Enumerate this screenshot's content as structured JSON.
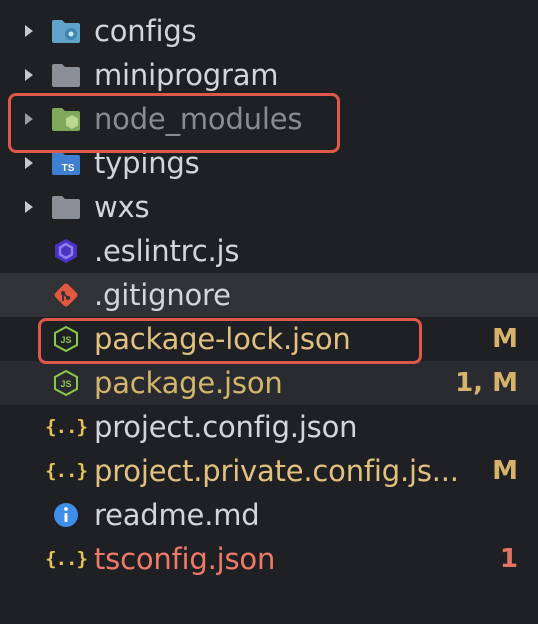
{
  "colors": {
    "default_text": "#d4d5d9",
    "ignored_text": "#8a8b90",
    "modified_text": "#e2c080",
    "modified_badge": "#d6b36a",
    "error_text": "#f07a6a",
    "error_badge": "#e07562",
    "highlight_border": "#e0584c"
  },
  "tree": [
    {
      "label": "configs",
      "type": "folder",
      "icon": "folder-config-icon",
      "badge": ""
    },
    {
      "label": "miniprogram",
      "type": "folder",
      "icon": "folder-icon",
      "badge": ""
    },
    {
      "label": "node_modules",
      "type": "folder",
      "icon": "folder-node-icon",
      "badge": ""
    },
    {
      "label": "typings",
      "type": "folder",
      "icon": "folder-typescript-icon",
      "badge": ""
    },
    {
      "label": "wxs",
      "type": "folder",
      "icon": "folder-icon",
      "badge": ""
    },
    {
      "label": ".eslintrc.js",
      "type": "file",
      "icon": "eslint-icon",
      "badge": ""
    },
    {
      "label": ".gitignore",
      "type": "file",
      "icon": "git-icon",
      "badge": ""
    },
    {
      "label": "package-lock.json",
      "type": "file",
      "icon": "nodejs-icon",
      "badge": "M"
    },
    {
      "label": "package.json",
      "type": "file",
      "icon": "nodejs-icon",
      "badge": "1, M"
    },
    {
      "label": "project.config.json",
      "type": "file",
      "icon": "json-icon",
      "badge": ""
    },
    {
      "label": "project.private.config.js...",
      "type": "file",
      "icon": "json-icon",
      "badge": "M"
    },
    {
      "label": "readme.md",
      "type": "file",
      "icon": "info-icon",
      "badge": ""
    },
    {
      "label": "tsconfig.json",
      "type": "file",
      "icon": "json-icon",
      "badge": "1"
    }
  ],
  "icon_glyphs": {
    "json": "{..}",
    "typescript": "TS",
    "nodejs": "JS",
    "info": "i"
  }
}
